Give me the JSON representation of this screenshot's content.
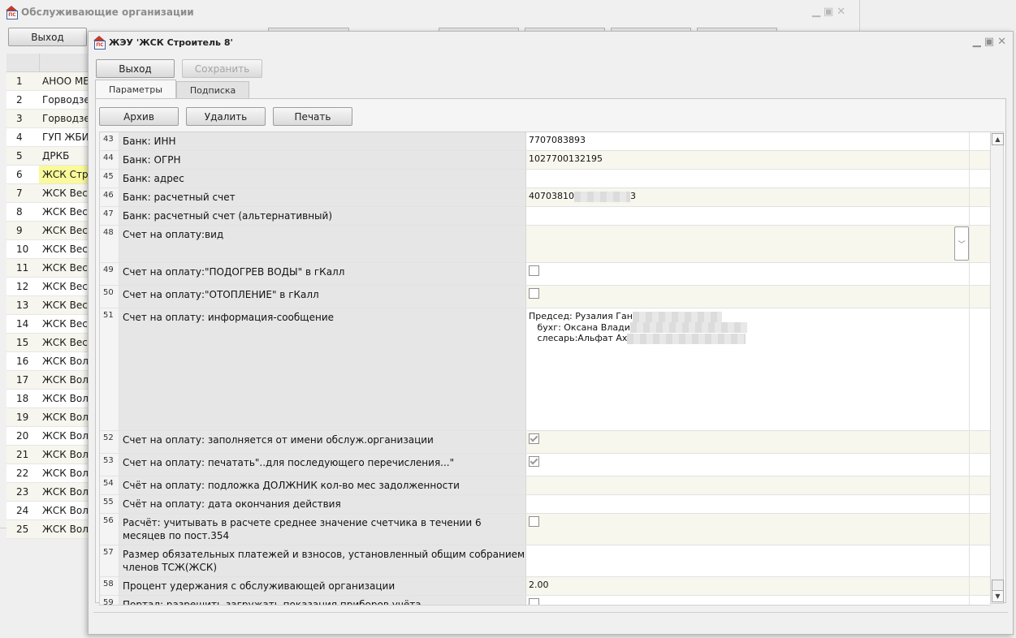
{
  "background_window": {
    "title": "Обслуживающие организации",
    "exit_label": "Выход",
    "rows": [
      {
        "n": "1",
        "name": "АНОО МЕ"
      },
      {
        "n": "2",
        "name": "Горводзе"
      },
      {
        "n": "3",
        "name": "Горводзе"
      },
      {
        "n": "4",
        "name": "ГУП ЖБИ"
      },
      {
        "n": "5",
        "name": "ДРКБ"
      },
      {
        "n": "6",
        "name": "ЖСК  Стр"
      },
      {
        "n": "7",
        "name": "ЖСК Весн"
      },
      {
        "n": "8",
        "name": "ЖСК Весн"
      },
      {
        "n": "9",
        "name": "ЖСК Весн"
      },
      {
        "n": "10",
        "name": "ЖСК Весн"
      },
      {
        "n": "11",
        "name": "ЖСК Весн"
      },
      {
        "n": "12",
        "name": "ЖСК Весн"
      },
      {
        "n": "13",
        "name": "ЖСК Весн"
      },
      {
        "n": "14",
        "name": "ЖСК Весн"
      },
      {
        "n": "15",
        "name": "ЖСК Весн"
      },
      {
        "n": "16",
        "name": "ЖСК Волг"
      },
      {
        "n": "17",
        "name": "ЖСК Волг"
      },
      {
        "n": "18",
        "name": "ЖСК Волг"
      },
      {
        "n": "19",
        "name": "ЖСК Волг"
      },
      {
        "n": "20",
        "name": "ЖСК Волг"
      },
      {
        "n": "21",
        "name": "ЖСК Волг"
      },
      {
        "n": "22",
        "name": "ЖСК Волг"
      },
      {
        "n": "23",
        "name": "ЖСК Волг"
      },
      {
        "n": "24",
        "name": "ЖСК Волг"
      },
      {
        "n": "25",
        "name": "ЖСК Волг"
      }
    ]
  },
  "window": {
    "title": "ЖЭУ 'ЖСК  Строитель 8'",
    "exit_label": "Выход",
    "save_label": "Сохранить",
    "tabs": [
      "Параметры",
      "Подписка"
    ],
    "buttons": {
      "archive": "Архив",
      "delete": "Удалить",
      "print": "Печать"
    }
  },
  "params": {
    "r43": {
      "n": "43",
      "label": "Банк: ИНН",
      "value": "7707083893"
    },
    "r44": {
      "n": "44",
      "label": "Банк: ОГРН",
      "value": "1027700132195"
    },
    "r45": {
      "n": "45",
      "label": "Банк: адрес",
      "value": ""
    },
    "r46": {
      "n": "46",
      "label": "Банк: расчетный счет",
      "value_a": "40703810",
      "value_b": "3"
    },
    "r47": {
      "n": "47",
      "label": "Банк: расчетный счет (альтернативный)",
      "value": ""
    },
    "r48": {
      "n": "48",
      "label": "Счет на оплату:вид",
      "value": ""
    },
    "r49": {
      "n": "49",
      "label": "Счет на оплату:\"ПОДОГРЕВ ВОДЫ\" в гКалл",
      "checked": false
    },
    "r50": {
      "n": "50",
      "label": "Счет на оплату:\"ОТОПЛЕНИЕ\" в гКалл",
      "checked": false
    },
    "r51": {
      "n": "51",
      "label": "Счет на оплату: информация-сообщение",
      "line1": "Председ: Рузалия Ган",
      "line2": "   бухг: Оксана Влади",
      "line3": "   слесарь:Альфат Ах"
    },
    "r52": {
      "n": "52",
      "label": "Счет на оплату: заполняется от имени обслуж.организации",
      "checked": true
    },
    "r53": {
      "n": "53",
      "label": "Счет на оплату: печатать\"..для последующего перечисления...\"",
      "checked": true
    },
    "r54": {
      "n": "54",
      "label": "Счёт на оплату: подложка ДОЛЖНИК кол-во мес задолженности",
      "value": ""
    },
    "r55": {
      "n": "55",
      "label": "Счёт на оплату: дата окончания действия",
      "value": ""
    },
    "r56": {
      "n": "56",
      "label": "Расчёт: учитывать в расчете среднее значение счетчика в течении 6 месяцев по пост.354",
      "checked": false
    },
    "r57": {
      "n": "57",
      "label": "Размер обязательных платежей и взносов, установленный общим собранием членов ТСЖ(ЖСК)",
      "value": ""
    },
    "r58": {
      "n": "58",
      "label": "Процент удержания с обслуживающей организации",
      "value": "2.00"
    },
    "r59": {
      "n": "59",
      "label": "Портал: разрешить загружать показания приборов учёта",
      "checked": false
    }
  }
}
